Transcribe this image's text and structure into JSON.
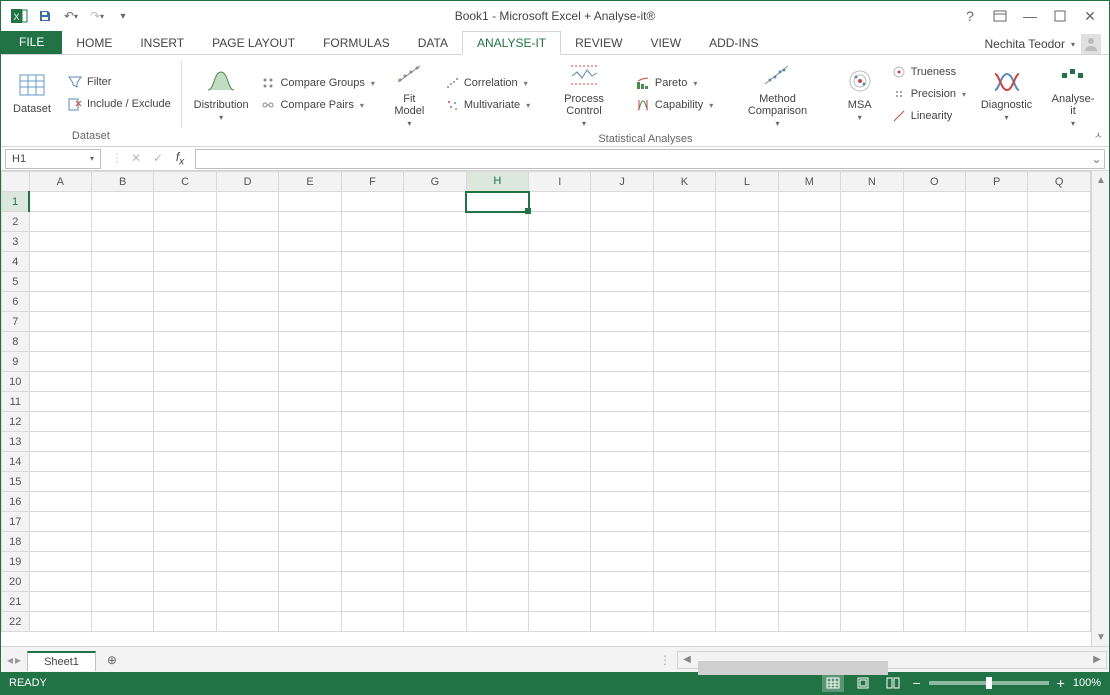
{
  "title": "Book1 - Microsoft Excel + Analyse-it®",
  "user": {
    "name": "Nechita Teodor"
  },
  "qat": {
    "save": "Save",
    "undo": "Undo",
    "redo": "Redo",
    "customize": "Customize"
  },
  "tabs": {
    "file": "FILE",
    "items": [
      "HOME",
      "INSERT",
      "PAGE LAYOUT",
      "FORMULAS",
      "DATA",
      "ANALYSE-IT",
      "REVIEW",
      "VIEW",
      "ADD-INS"
    ],
    "active_index": 5
  },
  "ribbon": {
    "groups": {
      "dataset": {
        "label": "Dataset",
        "dataset_btn": "Dataset",
        "filter": "Filter",
        "include_exclude": "Include / Exclude"
      },
      "statistical": {
        "label": "Statistical Analyses",
        "distribution": "Distribution",
        "compare_groups": "Compare Groups",
        "compare_pairs": "Compare Pairs",
        "fit_model": "Fit Model",
        "correlation": "Correlation",
        "multivariate": "Multivariate",
        "process_control": "Process Control",
        "pareto": "Pareto",
        "capability": "Capability",
        "method_comparison": "Method Comparison",
        "msa": "MSA",
        "trueness": "Trueness",
        "precision": "Precision",
        "linearity": "Linearity",
        "diagnostic": "Diagnostic",
        "analyse_it": "Analyse-it"
      }
    }
  },
  "formula_bar": {
    "name_box": "H1",
    "formula": ""
  },
  "grid": {
    "columns": [
      "A",
      "B",
      "C",
      "D",
      "E",
      "F",
      "G",
      "H",
      "I",
      "J",
      "K",
      "L",
      "M",
      "N",
      "O",
      "P",
      "Q"
    ],
    "rows": 22,
    "selected_cell": {
      "col": "H",
      "row": 1
    }
  },
  "sheet_tabs": {
    "active": "Sheet1"
  },
  "status": {
    "ready": "READY",
    "zoom": "100%"
  }
}
